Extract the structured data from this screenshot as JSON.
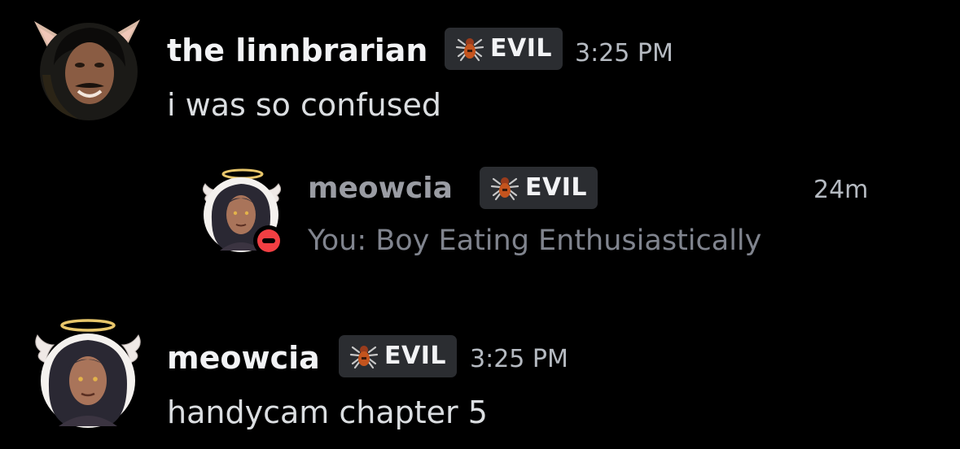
{
  "colors": {
    "background": "#000000",
    "username": "#f2f3f5",
    "message_text": "#dbdee1",
    "timestamp": "#b5bac1",
    "tag_background": "#2b2d31",
    "preview_muted": "#80848e",
    "dnd_status": "#f23f43"
  },
  "messages": [
    {
      "author": "the linnbrarian",
      "tag": {
        "label": "EVIL",
        "icon": "spider-icon"
      },
      "timestamp": "3:25 PM",
      "text": "i was so confused",
      "avatar": "man-with-cat-ears-avatar"
    },
    {
      "author": "meowcia",
      "tag": {
        "label": "EVIL",
        "icon": "spider-icon"
      },
      "timestamp": "3:25 PM",
      "text": "handycam chapter 5",
      "avatar": "angel-drawing-avatar"
    }
  ],
  "preview": {
    "author": "meowcia",
    "tag": {
      "label": "EVIL",
      "icon": "spider-icon"
    },
    "time_ago": "24m",
    "text": "You: Boy Eating Enthusiastically",
    "avatar": "angel-drawing-avatar",
    "status": "do-not-disturb"
  }
}
